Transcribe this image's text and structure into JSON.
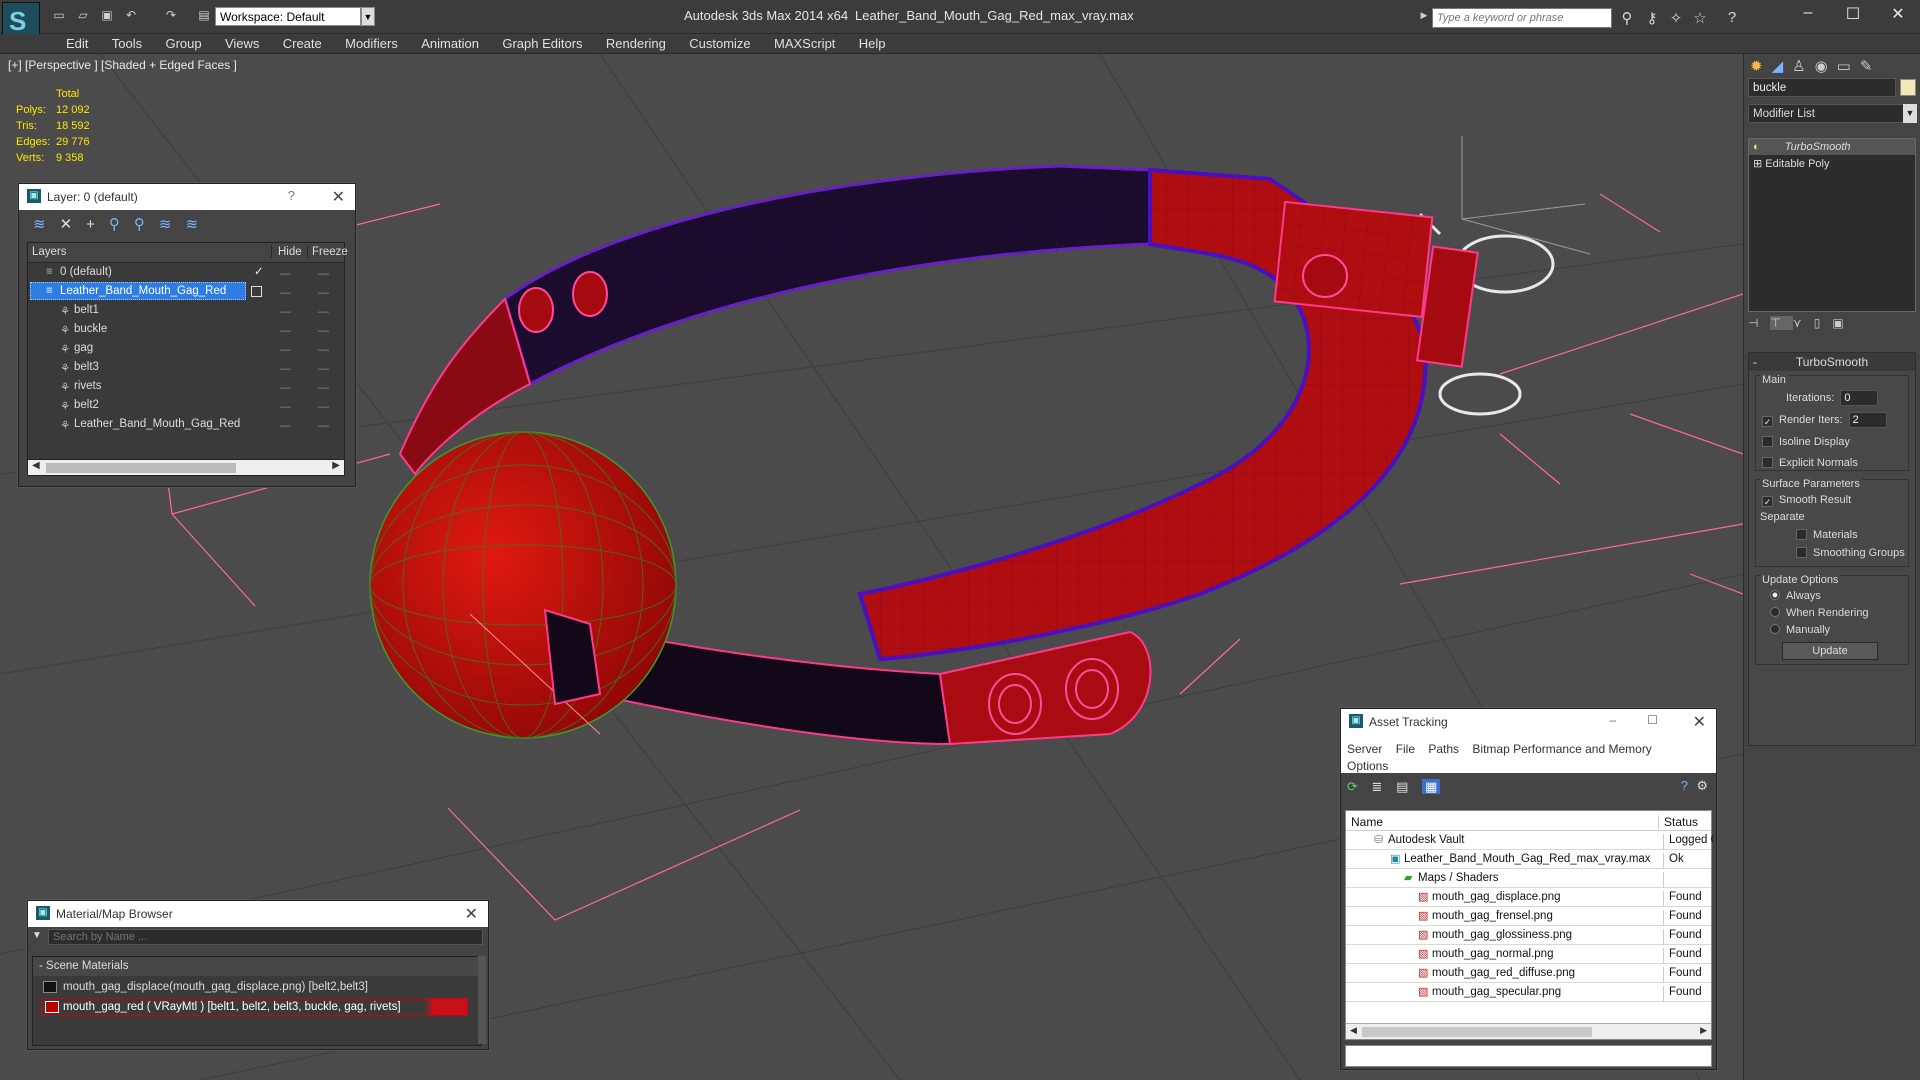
{
  "app": {
    "title": "Autodesk 3ds Max  2014 x64",
    "file": "Leather_Band_Mouth_Gag_Red_max_vray.max",
    "workspace": "Workspace: Default",
    "search_placeholder": "Type a keyword or phrase"
  },
  "menu": [
    "Edit",
    "Tools",
    "Group",
    "Views",
    "Create",
    "Modifiers",
    "Animation",
    "Graph Editors",
    "Rendering",
    "Customize",
    "MAXScript",
    "Help"
  ],
  "viewport": {
    "label": "[+] [Perspective ] [Shaded + Edged Faces ]",
    "stats_header": "Total",
    "stats": [
      {
        "k": "Polys:",
        "v": "12 092"
      },
      {
        "k": "Tris:",
        "v": "18 592"
      },
      {
        "k": "Edges:",
        "v": "29 776"
      },
      {
        "k": "Verts:",
        "v": "9 358"
      }
    ]
  },
  "layer_panel": {
    "title": "Layer: 0 (default)",
    "help": "?",
    "col_layers": "Layers",
    "col_hide": "Hide",
    "col_freeze": "Freeze",
    "rows": [
      {
        "name": "0 (default)"
      },
      {
        "name": "Leather_Band_Mouth_Gag_Red"
      },
      {
        "name": "belt1"
      },
      {
        "name": "buckle"
      },
      {
        "name": "gag"
      },
      {
        "name": "belt3"
      },
      {
        "name": "rivets"
      },
      {
        "name": "belt2"
      },
      {
        "name": "Leather_Band_Mouth_Gag_Red"
      }
    ]
  },
  "material_browser": {
    "title": "Material/Map Browser",
    "search_placeholder": "Search by Name ...",
    "section": "- Scene Materials",
    "items": [
      "mouth_gag_displace(mouth_gag_displace.png) [belt2,belt3]",
      "mouth_gag_red  ( VRayMtl ) [belt1, belt2, belt3, buckle, gag, rivets]"
    ]
  },
  "asset_tracking": {
    "title": "Asset Tracking",
    "menu": [
      "Server",
      "File",
      "Paths",
      "Bitmap Performance and Memory",
      "Options"
    ],
    "col_name": "Name",
    "col_status": "Status",
    "rows": [
      {
        "name": "Autodesk Vault",
        "status": "Logged O"
      },
      {
        "name": "Leather_Band_Mouth_Gag_Red_max_vray.max",
        "status": "Ok"
      },
      {
        "name": "Maps / Shaders",
        "status": ""
      },
      {
        "name": "mouth_gag_displace.png",
        "status": "Found"
      },
      {
        "name": "mouth_gag_frensel.png",
        "status": "Found"
      },
      {
        "name": "mouth_gag_glossiness.png",
        "status": "Found"
      },
      {
        "name": "mouth_gag_normal.png",
        "status": "Found"
      },
      {
        "name": "mouth_gag_red_diffuse.png",
        "status": "Found"
      },
      {
        "name": "mouth_gag_specular.png",
        "status": "Found"
      }
    ]
  },
  "command_panel": {
    "object_name": "buckle",
    "modifier_list": "Modifier List",
    "stack": [
      "TurboSmooth",
      "Editable Poly"
    ],
    "rollout_title": "TurboSmooth",
    "main": "Main",
    "iterations_label": "Iterations:",
    "iterations_value": "0",
    "render_iters_label": "Render Iters:",
    "render_iters_value": "2",
    "isoline": "Isoline Display",
    "explicit_normals": "Explicit Normals",
    "surface_params": "Surface Parameters",
    "smooth_result": "Smooth Result",
    "separate": "Separate",
    "materials": "Materials",
    "smoothing_groups": "Smoothing Groups",
    "update_options": "Update Options",
    "always": "Always",
    "when_rendering": "When Rendering",
    "manually": "Manually",
    "update_button": "Update"
  },
  "colors": {
    "accent": "#3a7bd5",
    "selection": "#2f7de1",
    "object_red": "#c41010",
    "wire_purple": "#5a12b0"
  }
}
